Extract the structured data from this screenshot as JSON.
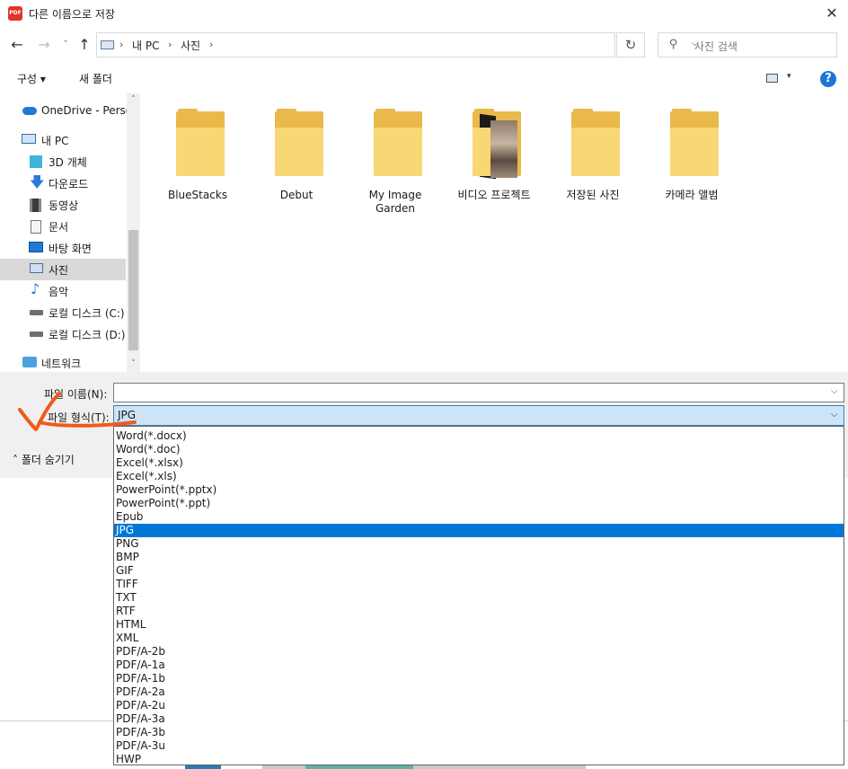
{
  "window": {
    "title": "다른 이름으로 저장",
    "app_icon": "PDF",
    "close_glyph": "✕"
  },
  "nav": {
    "back": "←",
    "forward": "→",
    "recent": "˅",
    "up": "↑",
    "breadcrumbs": [
      "내 PC",
      "사진"
    ],
    "separator": "›",
    "dropdown": "⌵",
    "refresh": "↻",
    "search_placeholder": "사진 검색"
  },
  "toolbar": {
    "organize": "구성 ▾",
    "new_folder": "새 폴더",
    "view_dropdown": "▾",
    "help": "?"
  },
  "sidebar": {
    "items": [
      {
        "label": "OneDrive - Person",
        "icon": "cloud-icon"
      },
      {
        "label": "내 PC",
        "icon": "computer-icon"
      },
      {
        "label": "3D 개체",
        "icon": "cube-icon"
      },
      {
        "label": "다운로드",
        "icon": "download-icon"
      },
      {
        "label": "동영상",
        "icon": "video-icon"
      },
      {
        "label": "문서",
        "icon": "document-icon"
      },
      {
        "label": "바탕 화면",
        "icon": "desktop-icon"
      },
      {
        "label": "사진",
        "icon": "pictures-icon",
        "selected": true
      },
      {
        "label": "음악",
        "icon": "music-icon"
      },
      {
        "label": "로컬 디스크 (C:)",
        "icon": "drive-icon"
      },
      {
        "label": "로컬 디스크 (D:)",
        "icon": "drive-icon"
      },
      {
        "label": "네트워크",
        "icon": "network-icon"
      }
    ],
    "scroll_up": "˄",
    "scroll_down": "˅"
  },
  "folders": [
    {
      "label": "BlueStacks"
    },
    {
      "label": "Debut"
    },
    {
      "label": "My Image Garden"
    },
    {
      "label": "비디오 프로젝트"
    },
    {
      "label": "저장된 사진"
    },
    {
      "label": "카메라 앨범"
    }
  ],
  "form": {
    "filename_label": "파일 이름(N):",
    "filename_value": "",
    "filetype_label": "파일 형식(T):",
    "filetype_value": "JPG",
    "dropdown_glyph": "⌵",
    "hide_folders": "˄  폴더 숨기기"
  },
  "file_types": [
    "Word(*.docx)",
    "Word(*.doc)",
    "Excel(*.xlsx)",
    "Excel(*.xls)",
    "PowerPoint(*.pptx)",
    "PowerPoint(*.ppt)",
    "Epub",
    "JPG",
    "PNG",
    "BMP",
    "GIF",
    "TIFF",
    "TXT",
    "RTF",
    "HTML",
    "XML",
    "PDF/A-2b",
    "PDF/A-1a",
    "PDF/A-1b",
    "PDF/A-2a",
    "PDF/A-2u",
    "PDF/A-3a",
    "PDF/A-3b",
    "PDF/A-3u",
    "HWP"
  ],
  "selected_file_type": "JPG",
  "colors": {
    "selection": "#0078d7",
    "select_highlight": "#cce4f7",
    "annotation": "#f05a1a",
    "folder": "#f8d775"
  }
}
